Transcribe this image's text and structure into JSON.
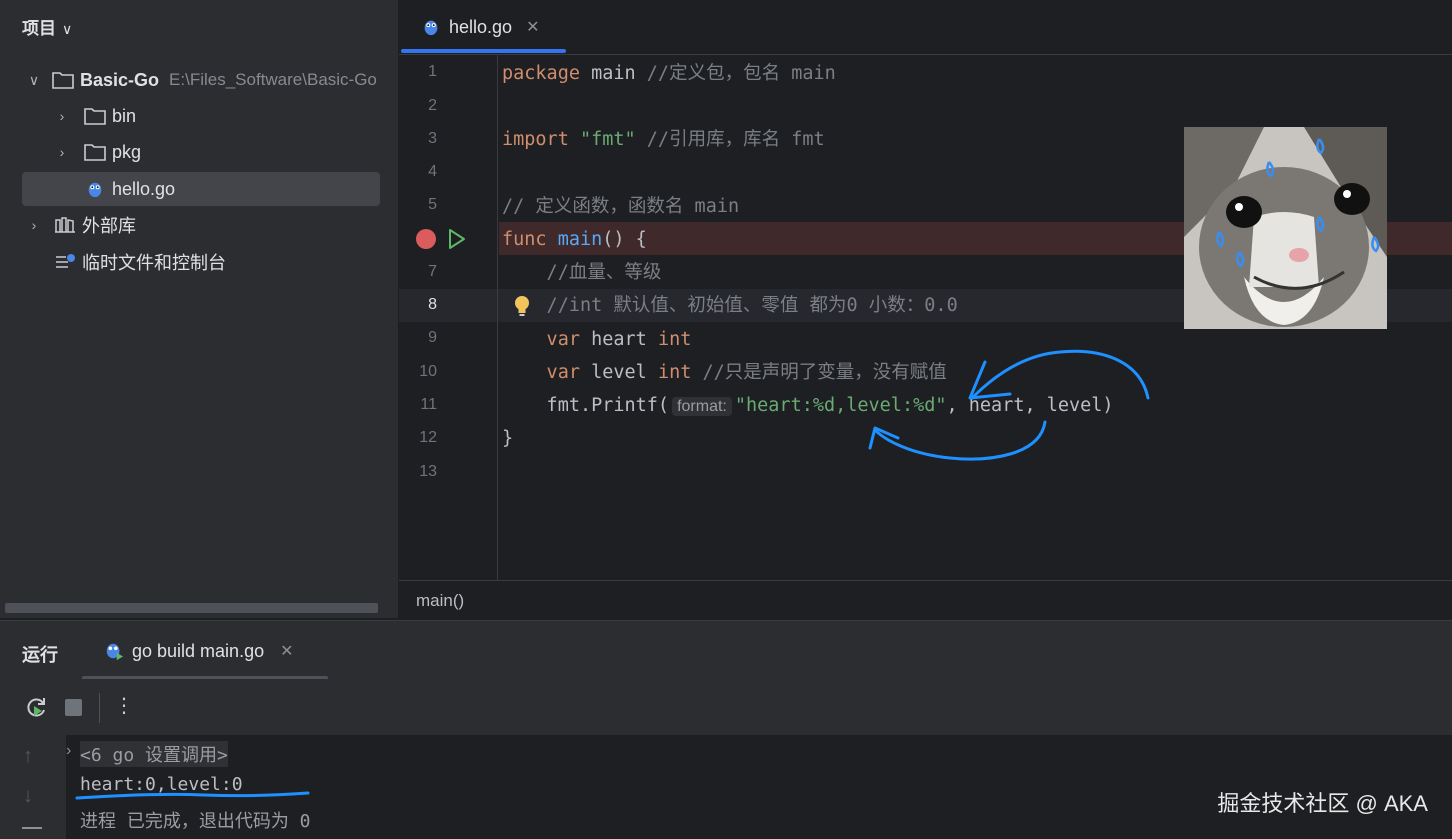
{
  "project_panel": {
    "header": "项目",
    "root": {
      "name": "Basic-Go",
      "path": "E:\\Files_Software\\Basic-Go"
    },
    "items": [
      "bin",
      "pkg",
      "hello.go"
    ],
    "external_libs": "外部库",
    "scratches": "临时文件和控制台"
  },
  "editor": {
    "tab": "hello.go",
    "lines": [
      "1",
      "2",
      "3",
      "4",
      "5",
      "6",
      "7",
      "8",
      "9",
      "10",
      "11",
      "12",
      "13"
    ],
    "code": {
      "l1_kw": "package",
      "l1_id": " main ",
      "l1_cm": "//定义包，包名 main",
      "l3_kw": "import",
      "l3_str": " \"fmt\"",
      "l3_cm": " //引用库，库名 fmt",
      "l5_cm": "// 定义函数，函数名 main",
      "l6_kw": "func",
      "l6_fn": " main",
      "l6_id": "() {",
      "l7_cm": "    //血量、等级",
      "l8_cm": "    //int 默认值、初始值、零值 都为0 小数：0.0",
      "l9_kw1": "    var",
      "l9_id": " heart ",
      "l9_kw2": "int",
      "l10_kw1": "    var",
      "l10_id": " level ",
      "l10_kw2": "int",
      "l10_cm": " //只是声明了变量，没有赋值",
      "l11_pre": "    fmt.Printf(",
      "l11_hint": "format:",
      "l11_str": "\"heart:%d,level:%d\"",
      "l11_post": ", heart, level)",
      "l12": "}"
    },
    "breadcrumb": "main()"
  },
  "run_panel": {
    "title": "运行",
    "tab": "go build main.go",
    "output": {
      "cmd": "<6 go 设置调用>",
      "result": "heart:0,level:0",
      "exit": "进程 已完成，退出代码为 0"
    }
  },
  "watermark": "掘金技术社区 @ AKA",
  "colors": {
    "accent": "#3574f0",
    "annotation": "#1e90ff",
    "breakpoint": "#db5c5c"
  }
}
